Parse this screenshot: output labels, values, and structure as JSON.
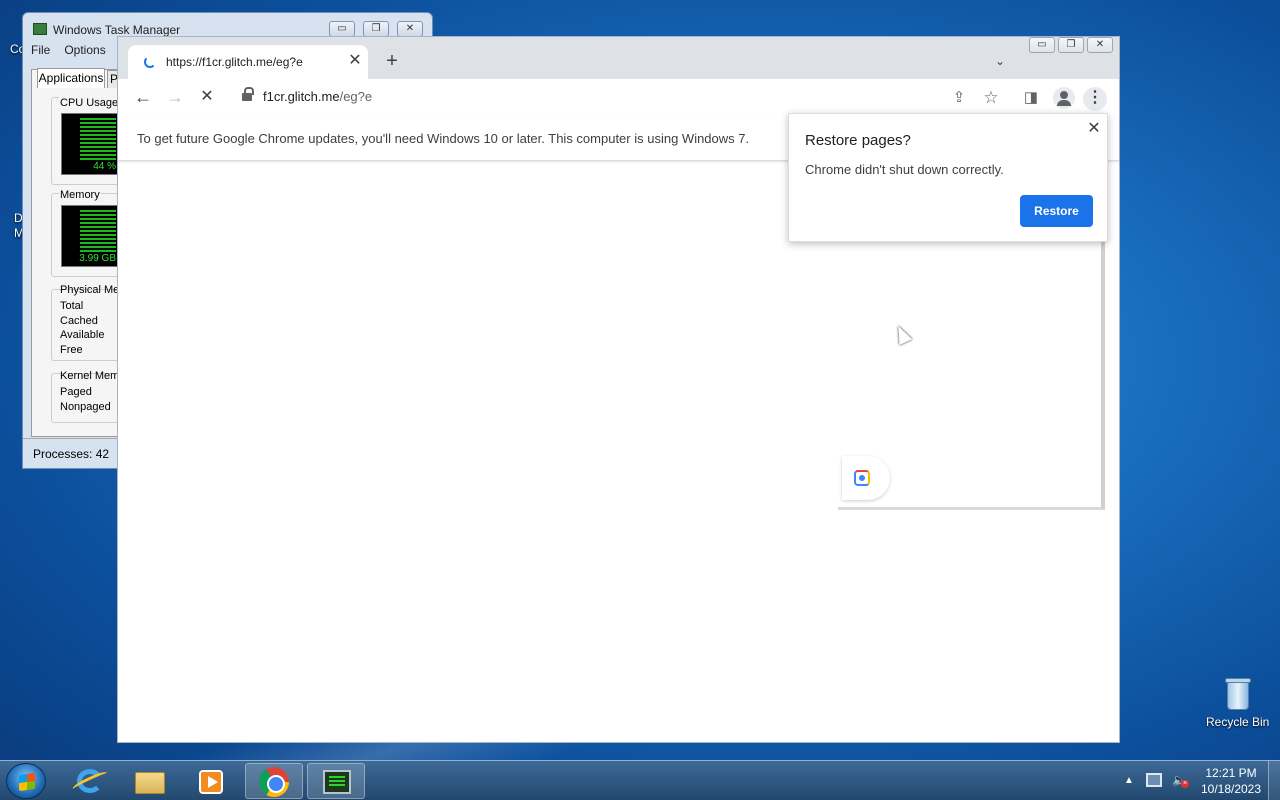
{
  "desktop": {
    "left_labels": [
      "Co",
      "D",
      "M"
    ],
    "recycle_bin_label": "Recycle Bin"
  },
  "task_manager": {
    "title": "Windows Task Manager",
    "menu": [
      "File",
      "Options"
    ],
    "tabs": [
      "Applications",
      "P"
    ],
    "cpu_group_title": "CPU Usage",
    "cpu_value": "44 %",
    "cpu_percent": 44,
    "memory_group_title": "Memory",
    "memory_value": "3.99 GB",
    "physical_memory_title": "Physical Mem",
    "physical_memory_rows": [
      "Total",
      "Cached",
      "Available",
      "Free"
    ],
    "kernel_memory_title": "Kernel Memo",
    "kernel_memory_rows": [
      "Paged",
      "Nonpaged"
    ],
    "status": "Processes: 42"
  },
  "chrome": {
    "tab_title": "https://f1cr.glitch.me/eg?e",
    "tab_close": "✕",
    "new_tab": "+",
    "tab_search": "⌄",
    "window_controls": [
      "▭",
      "❐",
      "✕"
    ],
    "back": "←",
    "forward": "→",
    "reload": "✕",
    "url_host": "f1cr.glitch.me",
    "url_path": "/eg?e",
    "share": "⇪",
    "bookmark": "☆",
    "side_panel": "◨",
    "menu": "⋮",
    "info_bar_text": "To get future Google Chrome updates, you'll need Windows 10 or later. This computer is using Windows 7."
  },
  "restore_popup": {
    "title": "Restore pages?",
    "message": "Chrome didn't shut down correctly.",
    "close": "✕",
    "button": "Restore"
  },
  "taskbar": {
    "clock_time": "12:21 PM",
    "clock_date": "10/18/2023",
    "tray_arrow": "▲"
  },
  "colors": {
    "accent": "#1a73e8",
    "desktop": "#1a6fbf",
    "taskbar": "#2d5983"
  }
}
